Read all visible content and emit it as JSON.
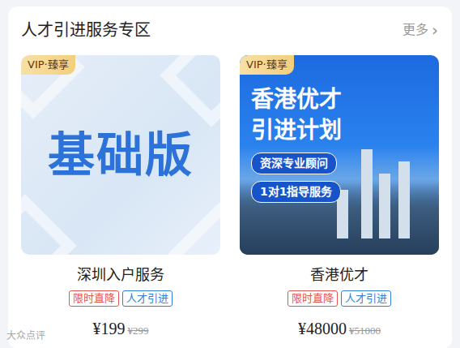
{
  "section": {
    "title": "人才引进服务专区",
    "more": "更多",
    "more_icon": "›"
  },
  "products": [
    {
      "badge": "VIP·臻享",
      "cover": {
        "kind": "plain",
        "lines": [
          "基础版"
        ],
        "pills": []
      },
      "name": "深圳入户服务",
      "tags": [
        {
          "label": "限时直降",
          "color": "#e4544f"
        },
        {
          "label": "人才引进",
          "color": "#2f7fd8"
        }
      ],
      "price": "¥199",
      "original_price": "¥299"
    },
    {
      "badge": "VIP·臻享",
      "cover": {
        "kind": "banner",
        "lines": [
          "香港优才",
          "引进计划"
        ],
        "pills": [
          "资深专业顾问",
          "1对1指导服务"
        ]
      },
      "name": "香港优才",
      "tags": [
        {
          "label": "限时直降",
          "color": "#e4544f"
        },
        {
          "label": "人才引进",
          "color": "#2f7fd8"
        }
      ],
      "price": "¥48000",
      "original_price": "¥51000"
    }
  ],
  "watermark": "大众点评"
}
